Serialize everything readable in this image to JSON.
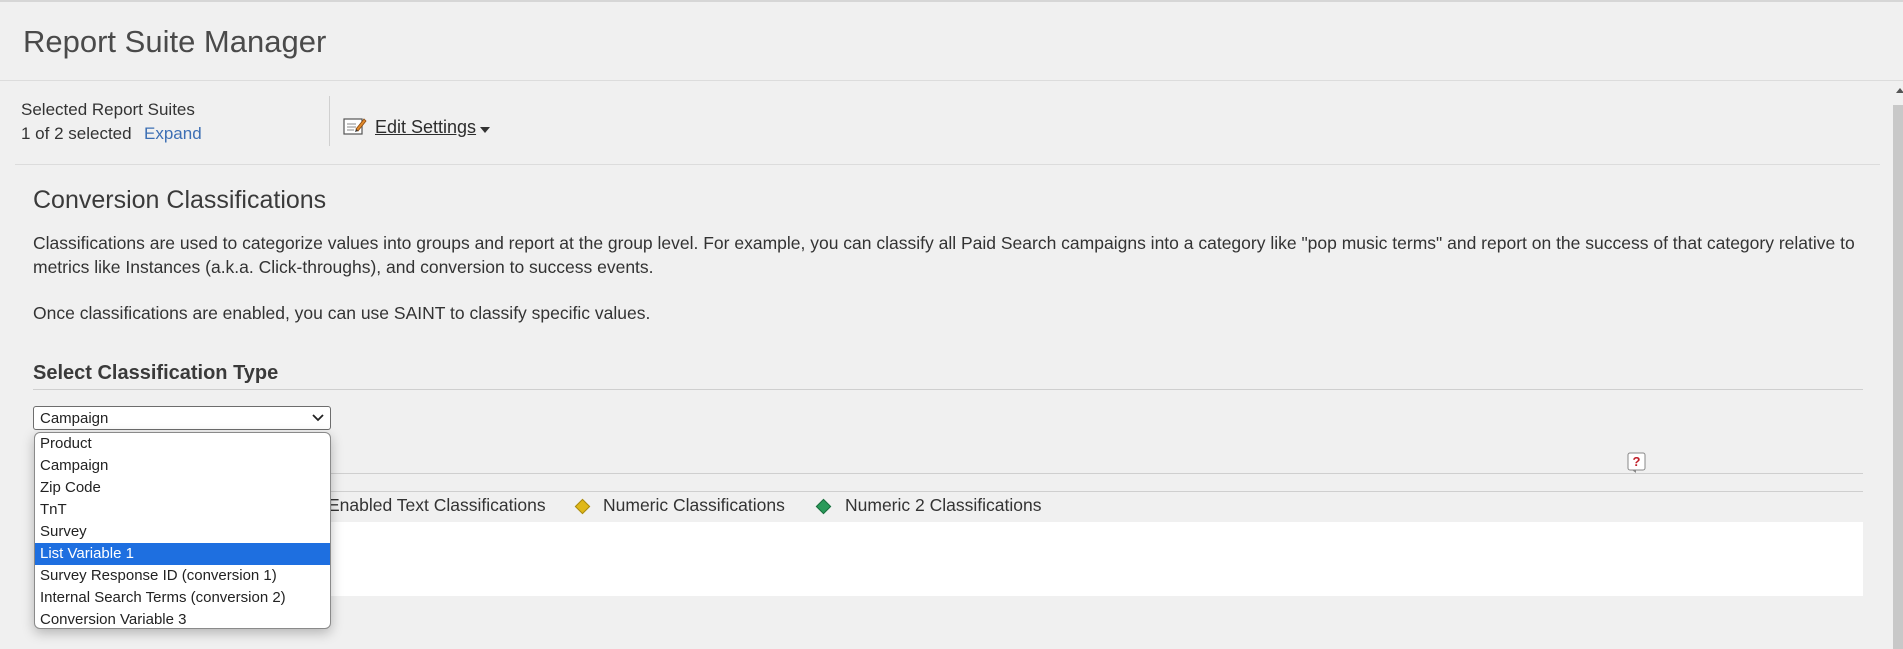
{
  "header": {
    "title": "Report Suite Manager"
  },
  "report_suites": {
    "label": "Selected Report Suites",
    "count": "1 of 2 selected",
    "expand": "Expand"
  },
  "toolbar": {
    "edit_settings": "Edit Settings"
  },
  "section": {
    "title": "Conversion Classifications",
    "description": "Classifications are used to categorize values into groups and report at the group level. For example, you can classify all Paid Search campaigns into a category like \"pop music terms\" and report on the success of that category relative to metrics like Instances (a.k.a. Click-throughs), and conversion to success events.",
    "saint_note": "Once classifications are enabled, you can use SAINT to classify specific values."
  },
  "classification": {
    "heading": "Select Classification Type",
    "selected": "Campaign",
    "options": [
      "Product",
      "Campaign",
      "Zip Code",
      "TnT",
      "Survey",
      "List Variable 1",
      "Survey Response ID (conversion 1)",
      "Internal Search Terms (conversion 2)",
      "Conversion Variable 3"
    ],
    "highlighted_option": "List Variable 1"
  },
  "legend": {
    "text_classifications": "Enabled Text Classifications",
    "numeric_classifications": "Numeric Classifications",
    "numeric2_classifications": "Numeric 2 Classifications"
  },
  "icons": {
    "edit": "edit-settings-icon",
    "help": "help-icon",
    "numeric": "yellow-diamond-icon",
    "numeric2": "green-diamond-icon"
  },
  "colors": {
    "link": "#3d6fb4",
    "highlight": "#1e6fe0",
    "numeric": "#e0b818",
    "numeric2": "#2a9a5a"
  }
}
